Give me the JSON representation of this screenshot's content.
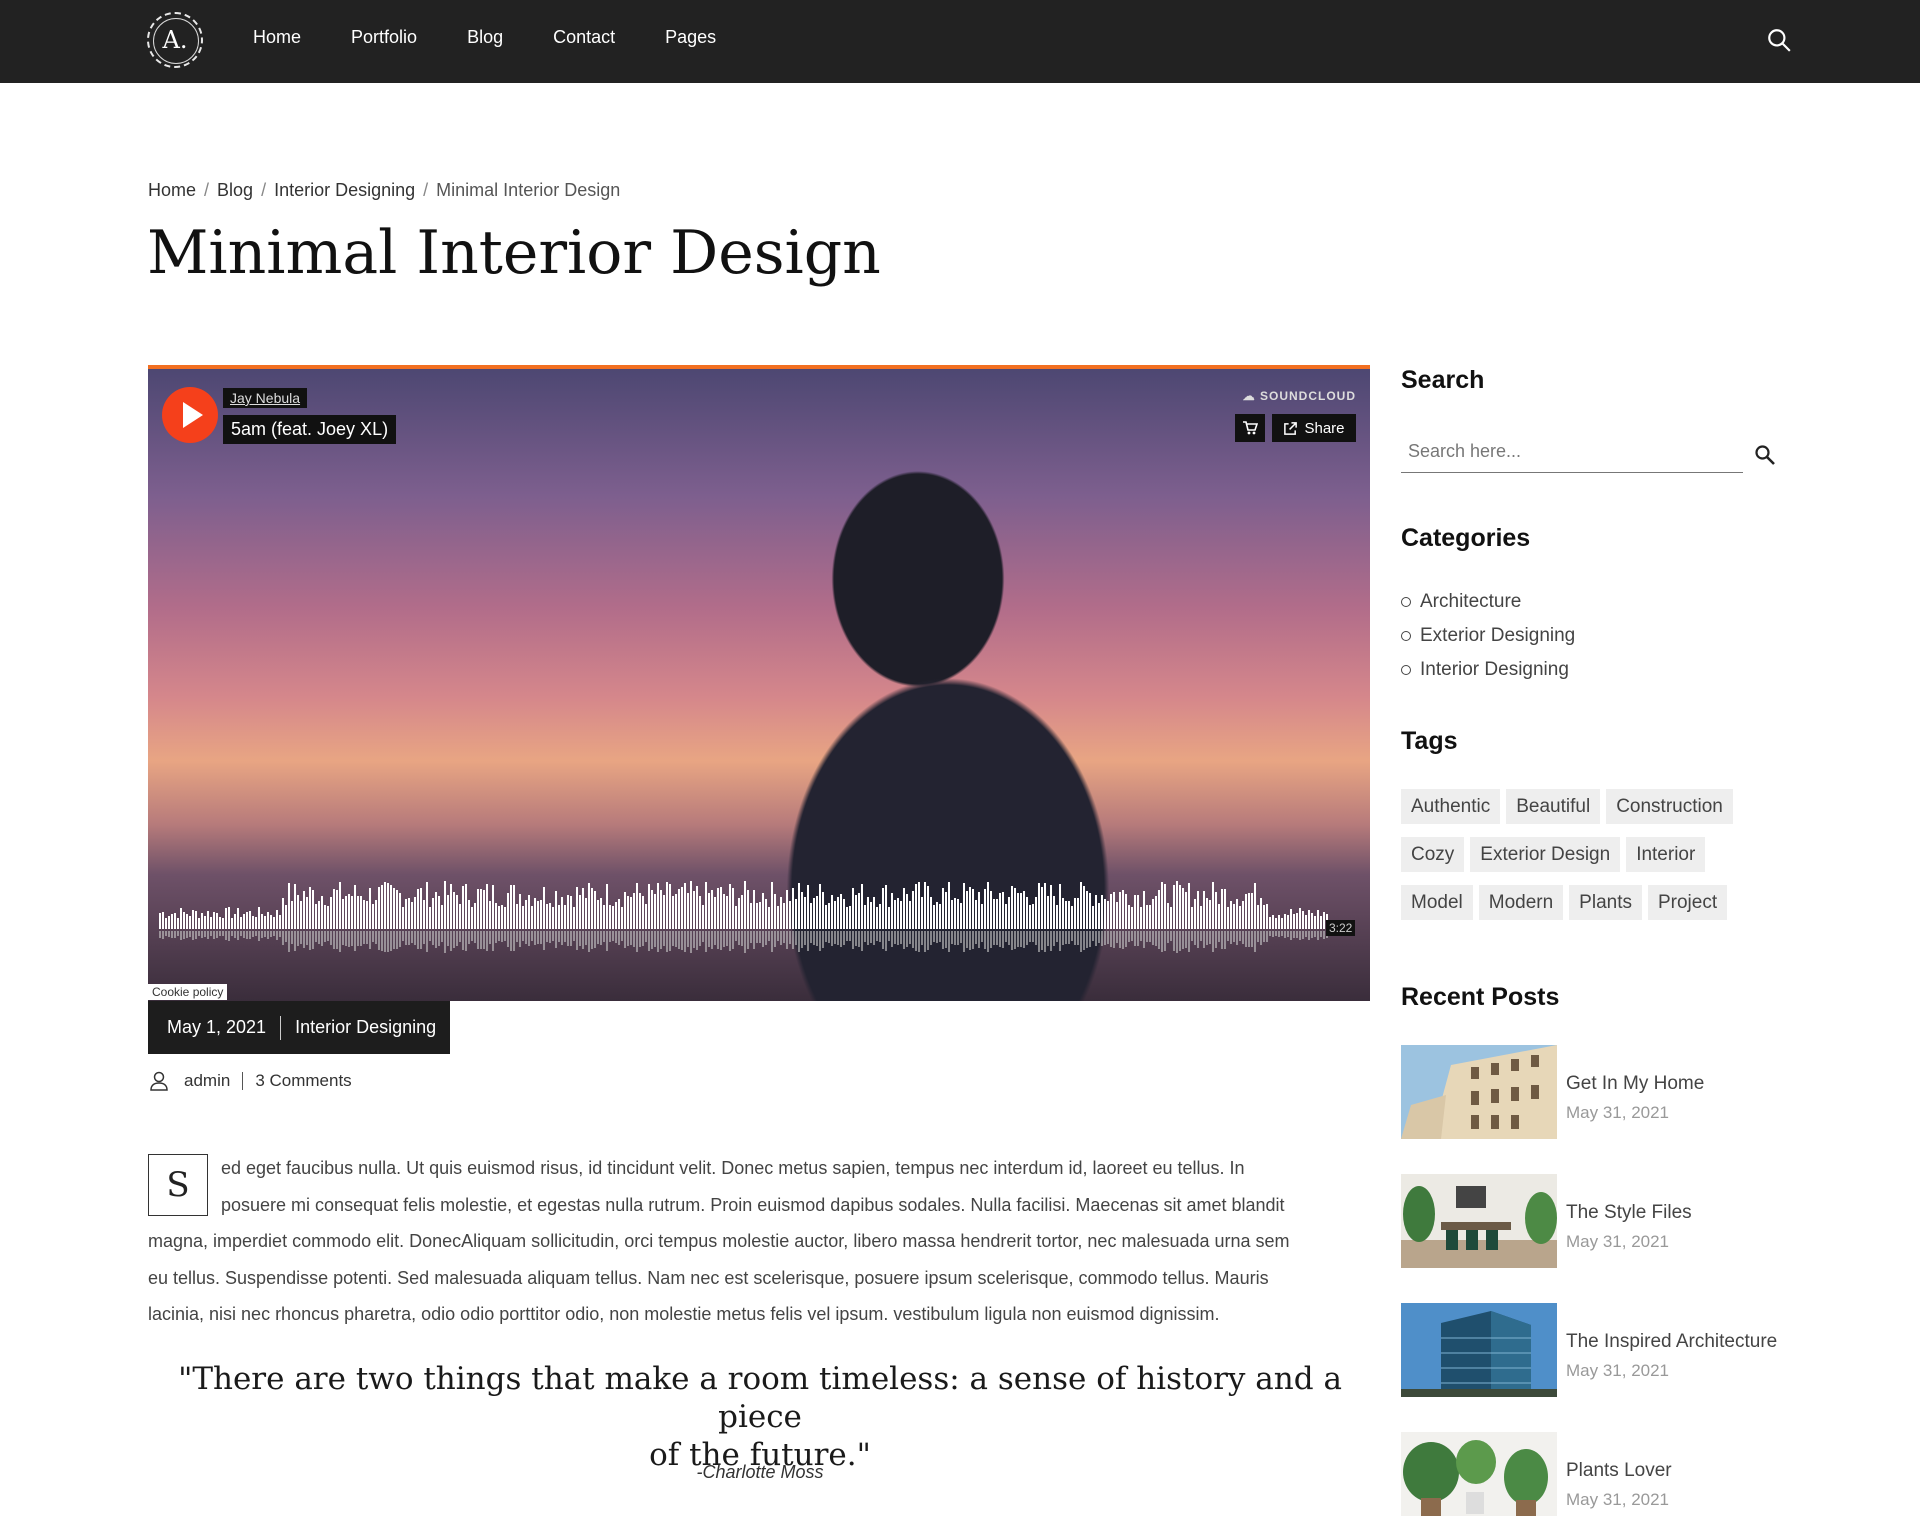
{
  "header": {
    "logo_text": "A.",
    "nav": [
      "Home",
      "Portfolio",
      "Blog",
      "Contact",
      "Pages"
    ]
  },
  "breadcrumb": [
    "Home",
    "Blog",
    "Interior Designing",
    "Minimal Interior Design"
  ],
  "page_title": "Minimal Interior Design",
  "player": {
    "artist": "Jay Nebula",
    "track": "5am (feat. Joey XL)",
    "brand": "SOUNDCLOUD",
    "share_label": "Share",
    "duration": "3:22",
    "cookie_label": "Cookie policy",
    "accent": "#f5401b"
  },
  "post": {
    "date": "May 1, 2021",
    "category": "Interior Designing",
    "author": "admin",
    "comments": "3 Comments",
    "dropcap": "S",
    "paragraph_lines": [
      "ed eget faucibus nulla. Ut quis euismod risus, id tincidunt velit. Donec metus sapien, tempus nec interdum id, laoreet eu tellus. In",
      "posuere mi consequat felis molestie, et egestas nulla rutrum. Proin euismod dapibus sodales. Nulla facilisi. Maecenas sit amet blandit",
      "magna, imperdiet commodo elit. DonecAliquam sollicitudin, orci tempus molestie auctor, libero massa hendrerit tortor, nec malesuada urna sem",
      "eu tellus. Suspendisse potenti. Sed malesuada aliquam tellus. Nam nec est scelerisque, posuere ipsum scelerisque, commodo tellus. Mauris",
      "lacinia, nisi nec rhoncus pharetra, odio odio porttitor odio, non molestie metus felis vel ipsum. vestibulum ligula non euismod dignissim."
    ],
    "quote_lines": [
      "\"There are two things that make a room timeless: a sense of history and a piece",
      "of the future.\""
    ],
    "quote_author": "-Charlotte Moss"
  },
  "sidebar": {
    "search_heading": "Search",
    "search_placeholder": "Search here...",
    "categories_heading": "Categories",
    "categories": [
      "Architecture",
      "Exterior Designing",
      "Interior Designing"
    ],
    "tags_heading": "Tags",
    "tags": [
      "Authentic",
      "Beautiful",
      "Construction",
      "Cozy",
      "Exterior Design",
      "Interior",
      "Model",
      "Modern",
      "Plants",
      "Project"
    ],
    "recent_heading": "Recent Posts",
    "recent_posts": [
      {
        "title": "Get In My Home",
        "date": "May 31, 2021"
      },
      {
        "title": "The Style Files",
        "date": "May 31, 2021"
      },
      {
        "title": "The Inspired Architecture",
        "date": "May 31, 2021"
      },
      {
        "title": "Plants Lover",
        "date": "May 31, 2021"
      }
    ]
  }
}
